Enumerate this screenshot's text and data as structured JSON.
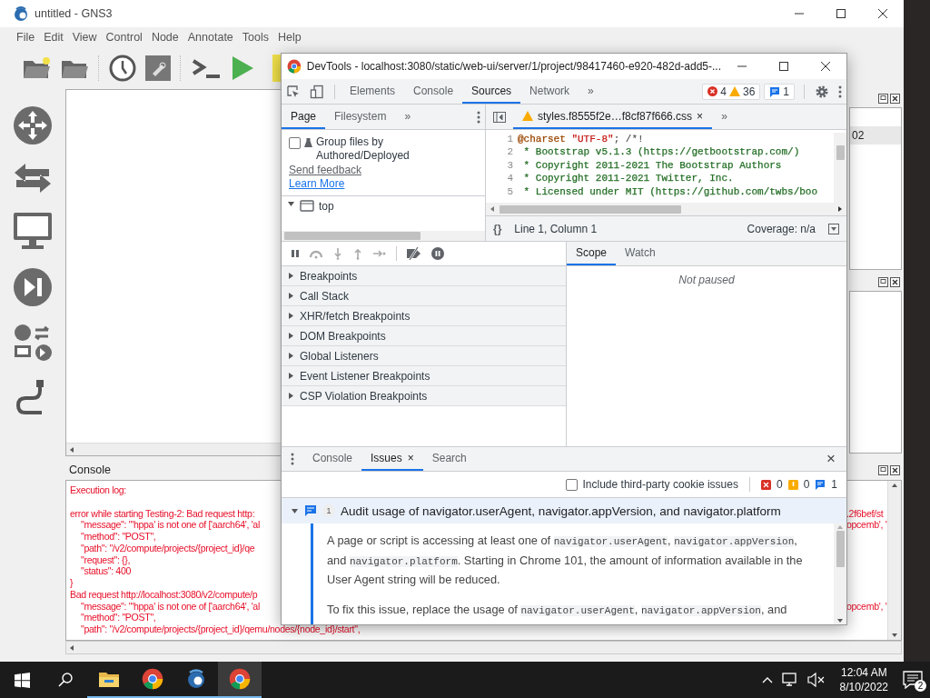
{
  "gns3": {
    "title": "untitled - GNS3",
    "menu": [
      {
        "label": "File"
      },
      {
        "label": "Edit"
      },
      {
        "label": "View"
      },
      {
        "label": "Control"
      },
      {
        "label": "Node"
      },
      {
        "label": "Annotate"
      },
      {
        "label": "Tools"
      },
      {
        "label": "Help"
      }
    ],
    "topology_dock": {
      "column_text": "02"
    },
    "console": {
      "title": "Console",
      "lines": [
        {
          "kind": "plain",
          "text": "Execution log:"
        },
        {
          "kind": "blank"
        },
        {
          "kind": "plain",
          "text": "error while starting Testing-2: Bad request http:",
          "tail": ".2f6bef/st"
        },
        {
          "kind": "field",
          "text": "\"message\": \"'hppa' is not one of ['aarch64', 'al",
          "tail": "opcemb', '"
        },
        {
          "kind": "field",
          "text": "\"method\": \"POST\","
        },
        {
          "kind": "field",
          "text": "\"path\": \"/v2/compute/projects/{project_id}/qe"
        },
        {
          "kind": "field",
          "text": "\"request\": {},"
        },
        {
          "kind": "field",
          "text": "\"status\": 400"
        },
        {
          "kind": "plain",
          "text": "}"
        },
        {
          "kind": "plain",
          "text": "Bad request http://localhost:3080/v2/compute/p"
        },
        {
          "kind": "field",
          "text": "\"message\": \"'hppa' is not one of ['aarch64', 'al",
          "tail": "opcemb', '"
        },
        {
          "kind": "field",
          "text": "\"method\": \"POST\","
        },
        {
          "kind": "field",
          "text": "\"path\": \"/v2/compute/projects/{project_id}/qemu/nodes/{node_id}/start\","
        }
      ]
    }
  },
  "devtools": {
    "title": "DevTools - localhost:3080/static/web-ui/server/1/project/98417460-e920-482d-add5-...",
    "tabs": [
      {
        "label": "Elements",
        "selected": false
      },
      {
        "label": "Console",
        "selected": false
      },
      {
        "label": "Sources",
        "selected": true
      },
      {
        "label": "Network",
        "selected": false
      }
    ],
    "more": "»",
    "errors": "4",
    "warnings": "36",
    "issues": "1",
    "navigator": {
      "tabs": [
        {
          "label": "Page",
          "selected": true
        },
        {
          "label": "Filesystem",
          "selected": false
        }
      ],
      "more": "»",
      "group_files": {
        "label": "Group files by Authored/Deployed",
        "checked": false
      },
      "links": [
        "Send feedback",
        "Learn More"
      ],
      "tree": [
        {
          "label": "top",
          "expanded": true
        }
      ]
    },
    "editor": {
      "file": "styles.f8555f2e…f8cf87f666.css",
      "close": "×",
      "more": "»",
      "lines": [
        {
          "number": "1",
          "parts": [
            {
              "text": "@charset",
              "color": "#994500"
            },
            {
              "text": " \"UTF-8\"",
              "color": "#c41a16"
            },
            {
              "text": "; /*!"
            }
          ]
        },
        {
          "number": "2",
          "parts": [
            {
              "text": " * Bootstrap v5.1.3 (https://getbootstrap.com/)",
              "color": "#236e25"
            }
          ]
        },
        {
          "number": "3",
          "parts": [
            {
              "text": " * Copyright 2011-2021 The Bootstrap Authors",
              "color": "#236e25"
            }
          ]
        },
        {
          "number": "4",
          "parts": [
            {
              "text": " * Copyright 2011-2021 Twitter, Inc.",
              "color": "#236e25"
            }
          ]
        },
        {
          "number": "5",
          "parts": [
            {
              "text": " * Licensed under MIT (https://github.com/twbs/boo",
              "color": "#236e25"
            }
          ]
        }
      ],
      "format": "{}",
      "position": "Line 1, Column 1",
      "coverage": "Coverage: n/a"
    },
    "sections": [
      {
        "label": "Breakpoints",
        "expanded": false
      },
      {
        "label": "Call Stack",
        "expanded": false
      },
      {
        "label": "XHR/fetch Breakpoints",
        "expanded": false
      },
      {
        "label": "DOM Breakpoints",
        "expanded": false
      },
      {
        "label": "Global Listeners",
        "expanded": false
      },
      {
        "label": "Event Listener Breakpoints",
        "expanded": false
      },
      {
        "label": "CSP Violation Breakpoints",
        "expanded": false
      }
    ],
    "scope_tabs": [
      {
        "label": "Scope",
        "selected": true
      },
      {
        "label": "Watch",
        "selected": false
      }
    ],
    "scope_message": "Not paused",
    "drawer": {
      "tabs": [
        {
          "label": "Console",
          "selected": false,
          "closable": false
        },
        {
          "label": "Issues",
          "selected": true,
          "closable": true
        },
        {
          "label": "Search",
          "selected": false,
          "closable": false
        }
      ],
      "tab_close": "×",
      "close": "×",
      "third_party": {
        "label": "Include third-party cookie issues",
        "checked": false
      },
      "counts": [
        "0",
        "0",
        "1"
      ],
      "issue": {
        "count": "1",
        "title": "Audit usage of navigator.userAgent, navigator.appVersion, and navigator.platform",
        "expanded": true,
        "paragraphs": [
          [
            {
              "text": "A page or script is accessing at least one of ",
              "code": false
            },
            {
              "text": "navigator.userAgent",
              "code": true
            },
            {
              "text": ", ",
              "code": false
            },
            {
              "text": "navigator.appVersion",
              "code": true
            },
            {
              "text": ", and ",
              "code": false
            },
            {
              "text": "navigator.platform",
              "code": true
            },
            {
              "text": ". Starting in Chrome 101, the amount of information available in the User Agent string will be reduced.",
              "code": false
            }
          ],
          [
            {
              "text": "To fix this issue, replace the usage of ",
              "code": false
            },
            {
              "text": "navigator.userAgent",
              "code": true
            },
            {
              "text": ", ",
              "code": false
            },
            {
              "text": "navigator.appVersion",
              "code": true
            },
            {
              "text": ", and",
              "code": false
            }
          ]
        ]
      }
    }
  },
  "taskbar": {
    "apps": [
      {
        "kind": "explorer",
        "selected": false,
        "running": true
      },
      {
        "kind": "chrome",
        "selected": false,
        "running": true
      },
      {
        "kind": "gns3",
        "selected": false,
        "running": true
      },
      {
        "kind": "chrome",
        "selected": true,
        "running": true
      }
    ],
    "time": "12:04 AM",
    "date": "8/10/2022",
    "notifications": "2"
  }
}
